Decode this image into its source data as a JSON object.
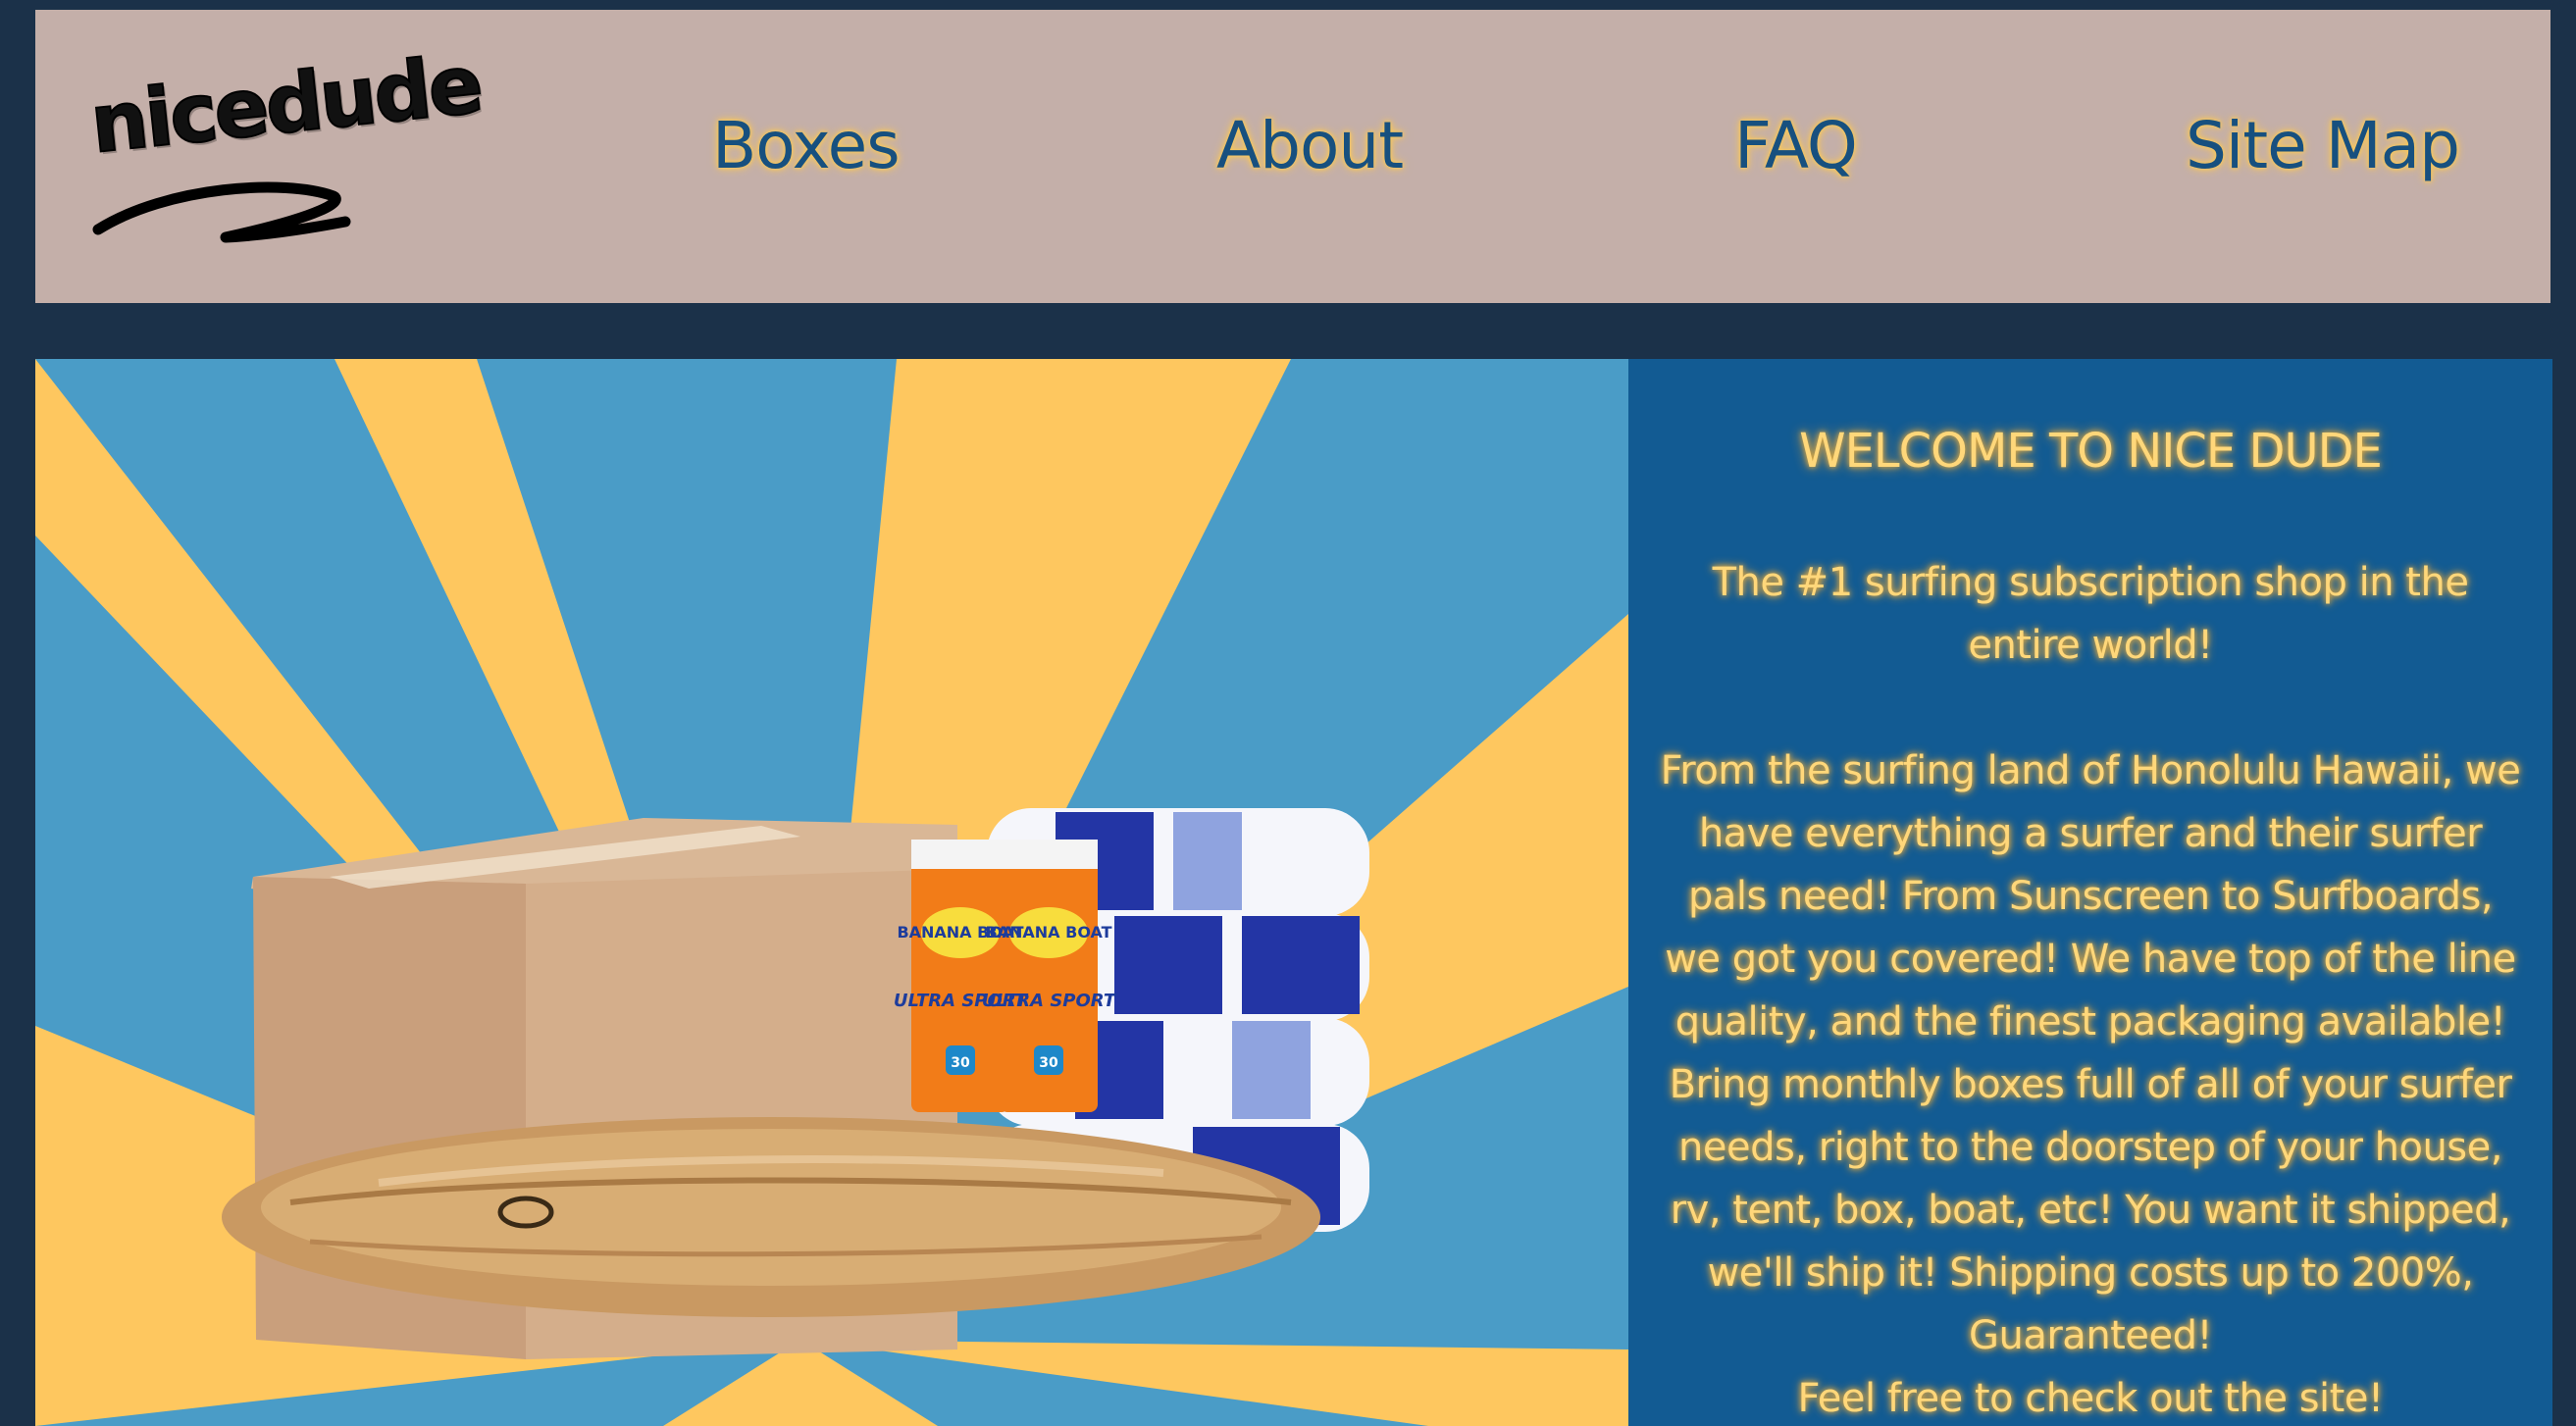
{
  "header": {
    "logo_text": "nicedude",
    "nav": [
      {
        "label": "Boxes"
      },
      {
        "label": "About"
      },
      {
        "label": "FAQ"
      },
      {
        "label": "Site Map"
      }
    ]
  },
  "hero": {
    "image_description_icon": "surf-box-image",
    "sunscreen_brand": "BANANA BOAT",
    "sunscreen_product": "ULTRA SPORT",
    "sunscreen_spf": "30"
  },
  "panel": {
    "title": "WELCOME TO NICE DUDE",
    "tagline": "The #1 surfing subscription shop in the entire world!",
    "body": "From the surfing land of Honolulu Hawaii, we have everything a surfer and their surfer pals need! From Sunscreen to Surfboards, we got you covered! We have top of the line quality, and the finest packaging available! Bring monthly boxes full of all of your surfer needs, right to the doorstep of your house, rv, tent, box, boat, etc! You want it shipped, we'll ship it! Shipping costs up to 200%, Guaranteed!",
    "cta": "Feel free to check out the site!"
  },
  "colors": {
    "page_bg": "#1b3149",
    "header_bg": "#c4afa9",
    "nav_text": "#17507f",
    "glow": "#f7c75c",
    "panel_bg": "#125b93",
    "panel_text": "#ffd77a",
    "ray_blue": "#4a9cc7",
    "ray_yellow": "#fec75f"
  }
}
